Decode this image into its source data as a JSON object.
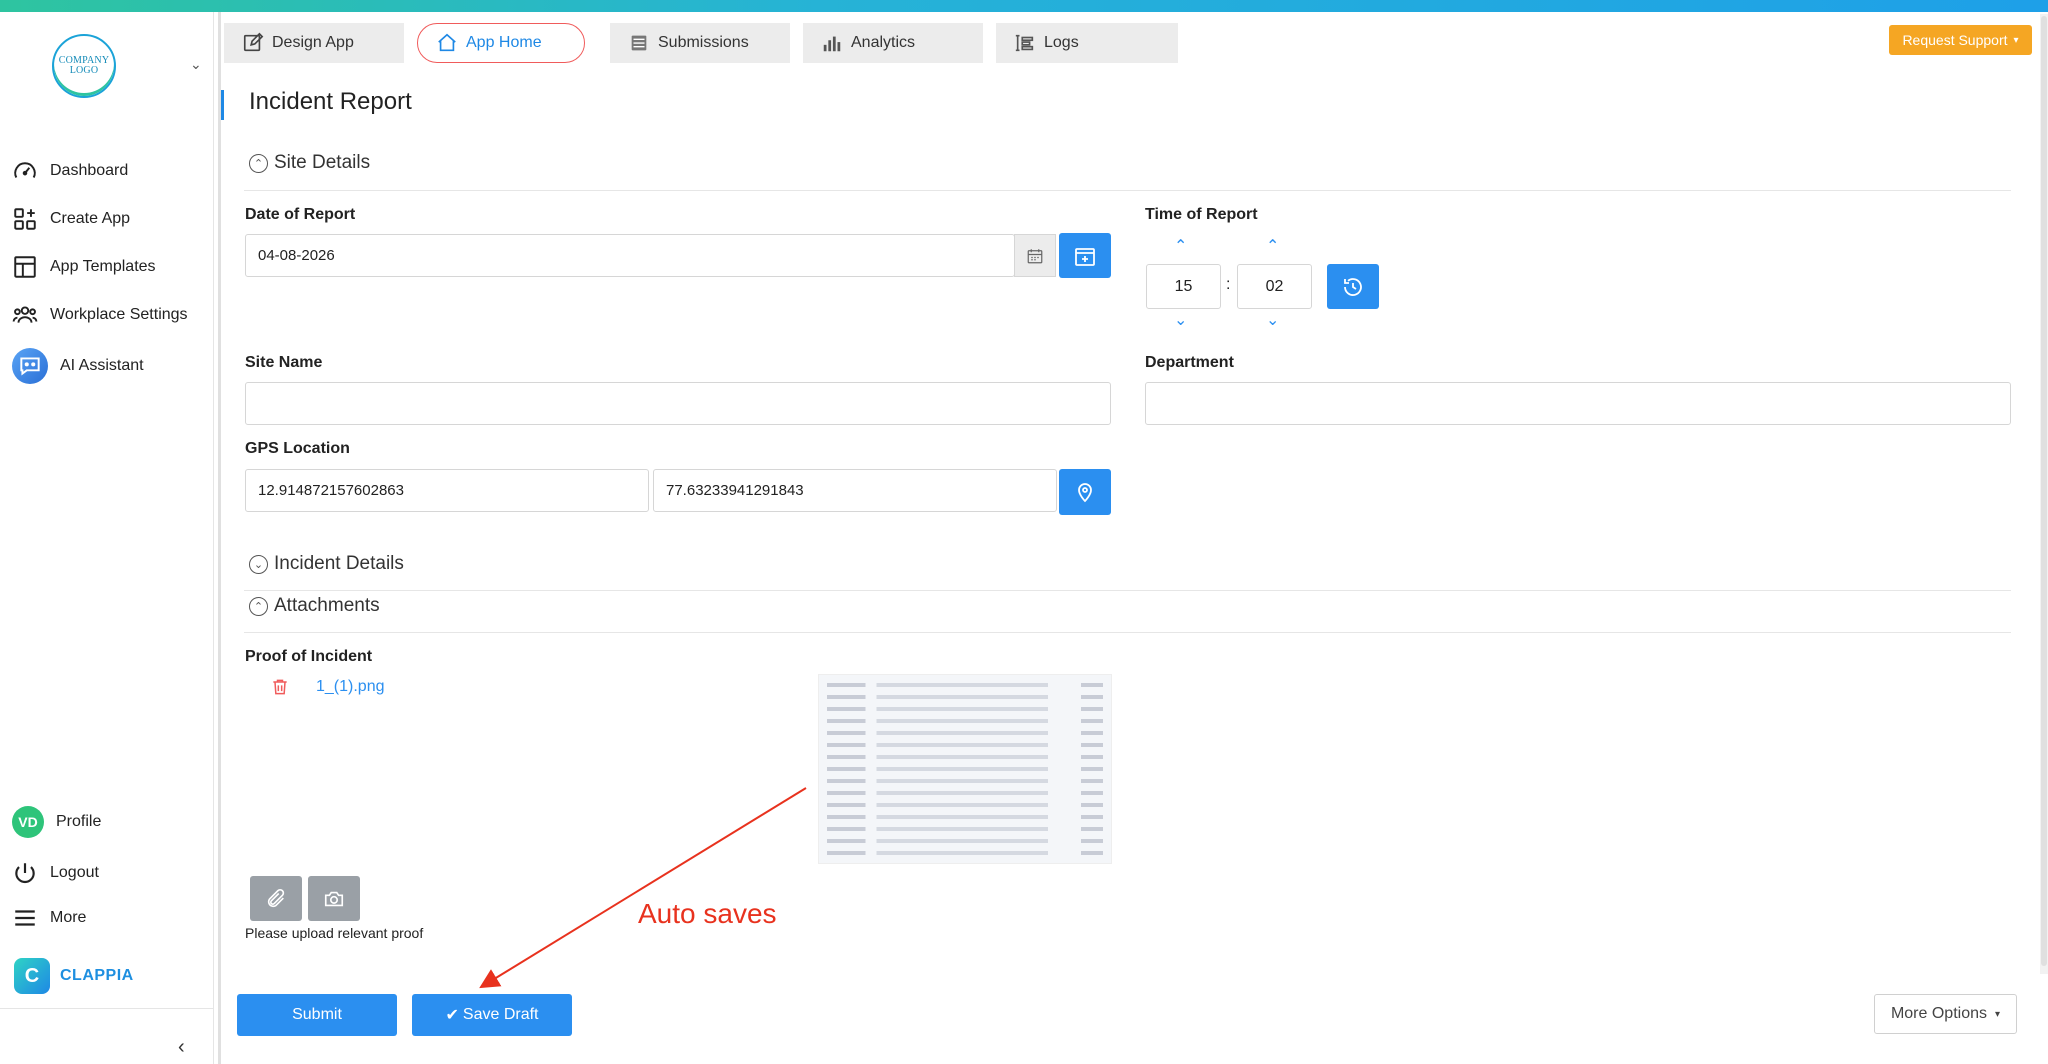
{
  "sidebar": {
    "logo_text": "COMPANY LOGO",
    "items": [
      {
        "label": "Dashboard",
        "icon": "gauge-icon"
      },
      {
        "label": "Create App",
        "icon": "apps-plus-icon"
      },
      {
        "label": "App Templates",
        "icon": "template-icon"
      },
      {
        "label": "Workplace Settings",
        "icon": "users-group-icon"
      },
      {
        "label": "AI Assistant",
        "icon": "ai-chat-icon"
      }
    ],
    "bottom": [
      {
        "label": "Profile",
        "avatar": "VD"
      },
      {
        "label": "Logout",
        "icon": "power-icon"
      },
      {
        "label": "More",
        "icon": "menu-icon"
      }
    ],
    "brand": "CLAPPIA",
    "brand_letter": "C"
  },
  "tabs": [
    {
      "label": "Design App",
      "icon": "edit-icon"
    },
    {
      "label": "App Home",
      "icon": "home-icon",
      "active": true
    },
    {
      "label": "Submissions",
      "icon": "list-icon"
    },
    {
      "label": "Analytics",
      "icon": "bar-chart-icon"
    },
    {
      "label": "Logs",
      "icon": "logs-icon"
    }
  ],
  "header": {
    "request_support": "Request Support"
  },
  "form": {
    "title": "Incident Report",
    "sections": {
      "site_details": "Site Details",
      "incident_details": "Incident Details",
      "attachments": "Attachments"
    },
    "date_label": "Date of Report",
    "date_value": "04-08-2026",
    "time_label": "Time of Report",
    "time_hour": "15",
    "time_sep": ":",
    "time_minute": "02",
    "site_name_label": "Site Name",
    "site_name_value": "",
    "department_label": "Department",
    "department_value": "",
    "gps_label": "GPS Location",
    "gps_lat": "12.914872157602863",
    "gps_lng": "77.63233941291843",
    "proof_label": "Proof of Incident",
    "proof_file": "1_(1).png",
    "upload_hint": "Please upload relevant proof"
  },
  "footer": {
    "submit": "Submit",
    "save_draft": "Save Draft",
    "more_options": "More Options"
  },
  "annotation": {
    "text": "Auto saves",
    "color": "#e8321e"
  },
  "colors": {
    "accent": "#2b8ff0",
    "support": "#f5a623",
    "danger": "#f05b5b"
  }
}
